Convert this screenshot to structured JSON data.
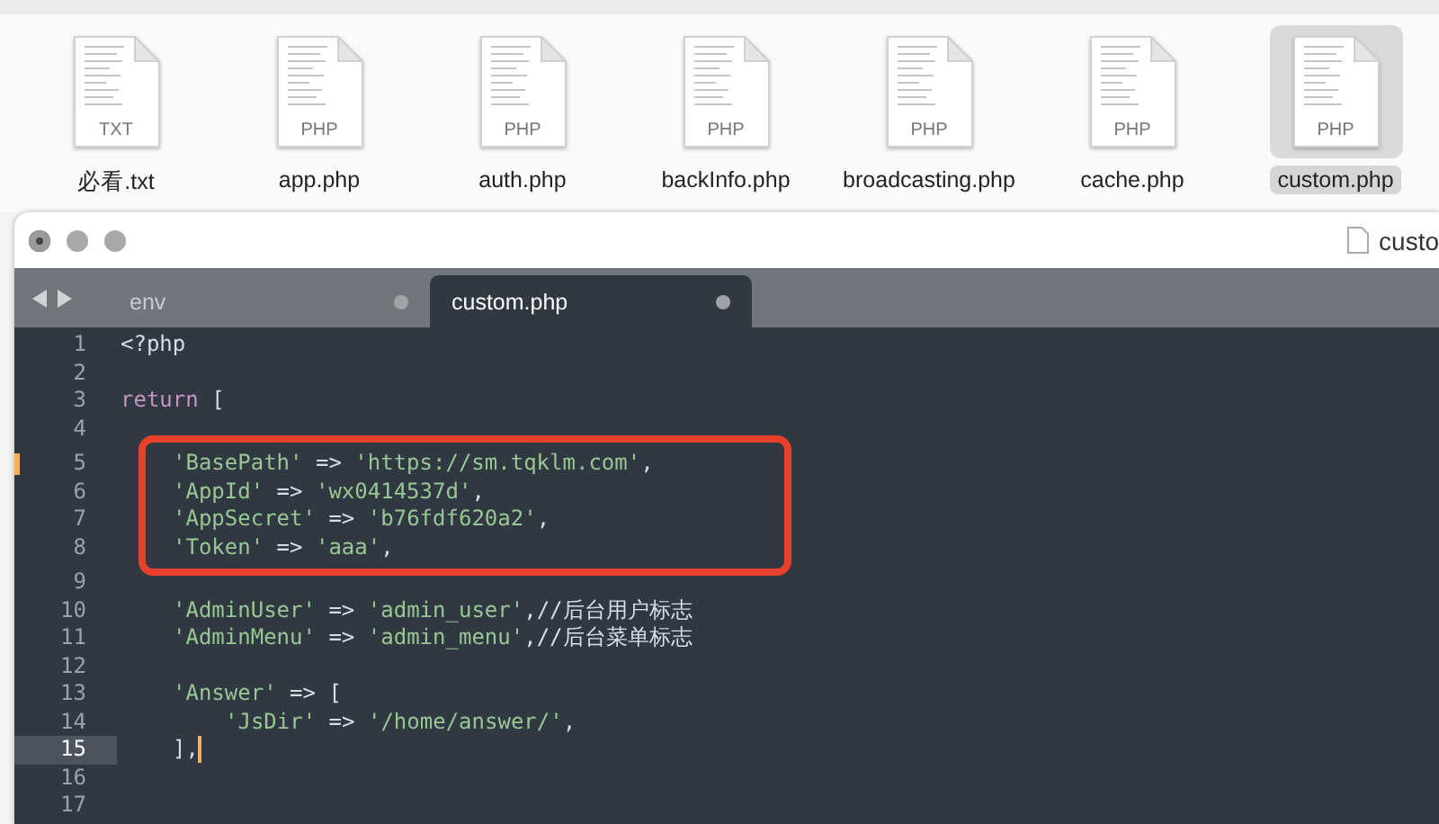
{
  "files": [
    {
      "name": "必看.txt",
      "type": "TXT",
      "selected": false
    },
    {
      "name": "app.php",
      "type": "PHP",
      "selected": false
    },
    {
      "name": "auth.php",
      "type": "PHP",
      "selected": false
    },
    {
      "name": "backInfo.php",
      "type": "PHP",
      "selected": false
    },
    {
      "name": "broadcasting.php",
      "type": "PHP",
      "selected": false
    },
    {
      "name": "cache.php",
      "type": "PHP",
      "selected": false
    },
    {
      "name": "custom.php",
      "type": "PHP",
      "selected": true
    }
  ],
  "window": {
    "title": "custo"
  },
  "tabs": [
    {
      "label": "env",
      "selected": false
    },
    {
      "label": "custom.php",
      "selected": true
    }
  ],
  "code": {
    "lines": [
      {
        "number": "1",
        "kind": "top",
        "tokens": [
          {
            "kind": "plain",
            "text": "<?php"
          }
        ]
      },
      {
        "number": "2",
        "kind": "blank"
      },
      {
        "number": "3",
        "kind": "top",
        "tokens": [
          {
            "kind": "keyword",
            "text": "return"
          },
          {
            "kind": "plain",
            "text": " ["
          }
        ]
      },
      {
        "number": "4",
        "kind": "blank"
      },
      {
        "number": "5",
        "modified": true,
        "boxed": true,
        "kind": "member",
        "tokens": [
          {
            "kind": "string",
            "text": "'BasePath'"
          },
          {
            "kind": "op",
            "text": " => "
          },
          {
            "kind": "string",
            "text": "'https://sm.tqklm.com'"
          },
          {
            "kind": "plain",
            "text": ","
          }
        ]
      },
      {
        "number": "6",
        "boxed": true,
        "kind": "member",
        "tokens": [
          {
            "kind": "string",
            "text": "'AppId'"
          },
          {
            "kind": "op",
            "text": " => "
          },
          {
            "kind": "string",
            "text": "'wx0414537d'"
          },
          {
            "kind": "plain",
            "text": ","
          }
        ]
      },
      {
        "number": "7",
        "boxed": true,
        "kind": "member",
        "tokens": [
          {
            "kind": "string",
            "text": "'AppSecret'"
          },
          {
            "kind": "op",
            "text": " => "
          },
          {
            "kind": "string",
            "text": "'b76fdf620a2'"
          },
          {
            "kind": "plain",
            "text": ","
          }
        ]
      },
      {
        "number": "8",
        "boxed": true,
        "kind": "member",
        "tokens": [
          {
            "kind": "string",
            "text": "'Token'"
          },
          {
            "kind": "op",
            "text": " => "
          },
          {
            "kind": "string",
            "text": "'aaa'"
          },
          {
            "kind": "plain",
            "text": ","
          }
        ]
      },
      {
        "number": "9",
        "kind": "blank"
      },
      {
        "number": "10",
        "kind": "member",
        "tokens": [
          {
            "kind": "string",
            "text": "'AdminUser'"
          },
          {
            "kind": "op",
            "text": " => "
          },
          {
            "kind": "string",
            "text": "'admin_user'"
          },
          {
            "kind": "plain",
            "text": ","
          },
          {
            "kind": "comment",
            "text": "//后台用户标志"
          }
        ]
      },
      {
        "number": "11",
        "kind": "member",
        "tokens": [
          {
            "kind": "string",
            "text": "'AdminMenu'"
          },
          {
            "kind": "op",
            "text": " => "
          },
          {
            "kind": "string",
            "text": "'admin_menu'"
          },
          {
            "kind": "plain",
            "text": ","
          },
          {
            "kind": "comment",
            "text": "//后台菜单标志"
          }
        ]
      },
      {
        "number": "12",
        "kind": "blank"
      },
      {
        "number": "13",
        "kind": "member",
        "tokens": [
          {
            "kind": "string",
            "text": "'Answer'"
          },
          {
            "kind": "op",
            "text": " => "
          },
          {
            "kind": "plain",
            "text": "["
          }
        ]
      },
      {
        "number": "14",
        "kind": "submember",
        "tokens": [
          {
            "kind": "string",
            "text": "'JsDir'"
          },
          {
            "kind": "op",
            "text": " => "
          },
          {
            "kind": "string",
            "text": "'/home/answer/'"
          },
          {
            "kind": "plain",
            "text": ","
          }
        ]
      },
      {
        "number": "15",
        "current": true,
        "kind": "member",
        "tokens": [
          {
            "kind": "plain",
            "text": "],"
          }
        ]
      },
      {
        "number": "16",
        "kind": "blank"
      },
      {
        "number": "17",
        "kind": "blank"
      }
    ]
  }
}
